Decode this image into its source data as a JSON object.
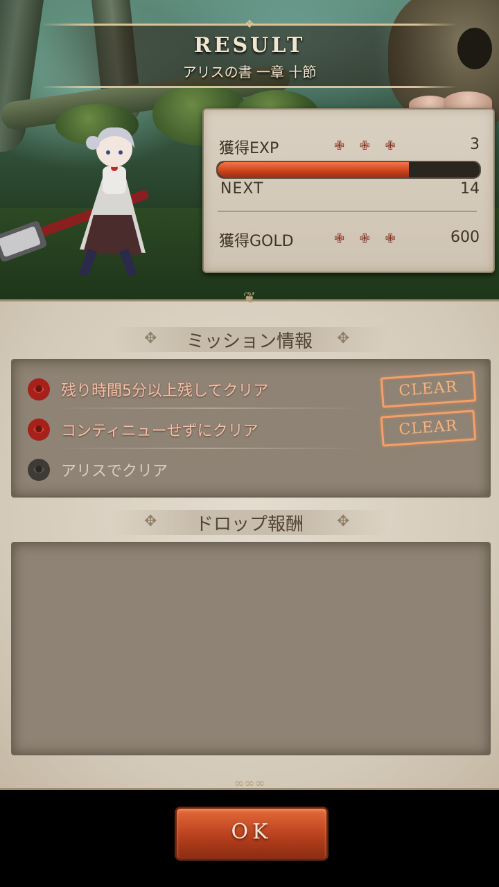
{
  "header": {
    "title": "RESULT",
    "subtitle": "アリスの書 一章 十節"
  },
  "stats": {
    "exp_label": "獲得EXP",
    "exp_value": "3",
    "next_label": "NEXT",
    "next_value": "14",
    "exp_progress_fraction": 0.73,
    "gold_label": "獲得GOLD",
    "gold_value": "600",
    "cross_glyph": "✙ ✙ ✙"
  },
  "missions": {
    "title": "ミッション情報",
    "items": [
      {
        "label": "残り時間5分以上残してクリア",
        "cleared": true,
        "stamp": "CLEAR"
      },
      {
        "label": "コンティニューせずにクリア",
        "cleared": true,
        "stamp": "CLEAR"
      },
      {
        "label": "アリスでクリア",
        "cleared": false
      }
    ]
  },
  "drops": {
    "title": "ドロップ報酬",
    "items": []
  },
  "ok_button": {
    "label": "OK"
  },
  "colors": {
    "accent": "#c8421b",
    "stamp": "#f3a06a",
    "parchment": "#d4cab9"
  }
}
